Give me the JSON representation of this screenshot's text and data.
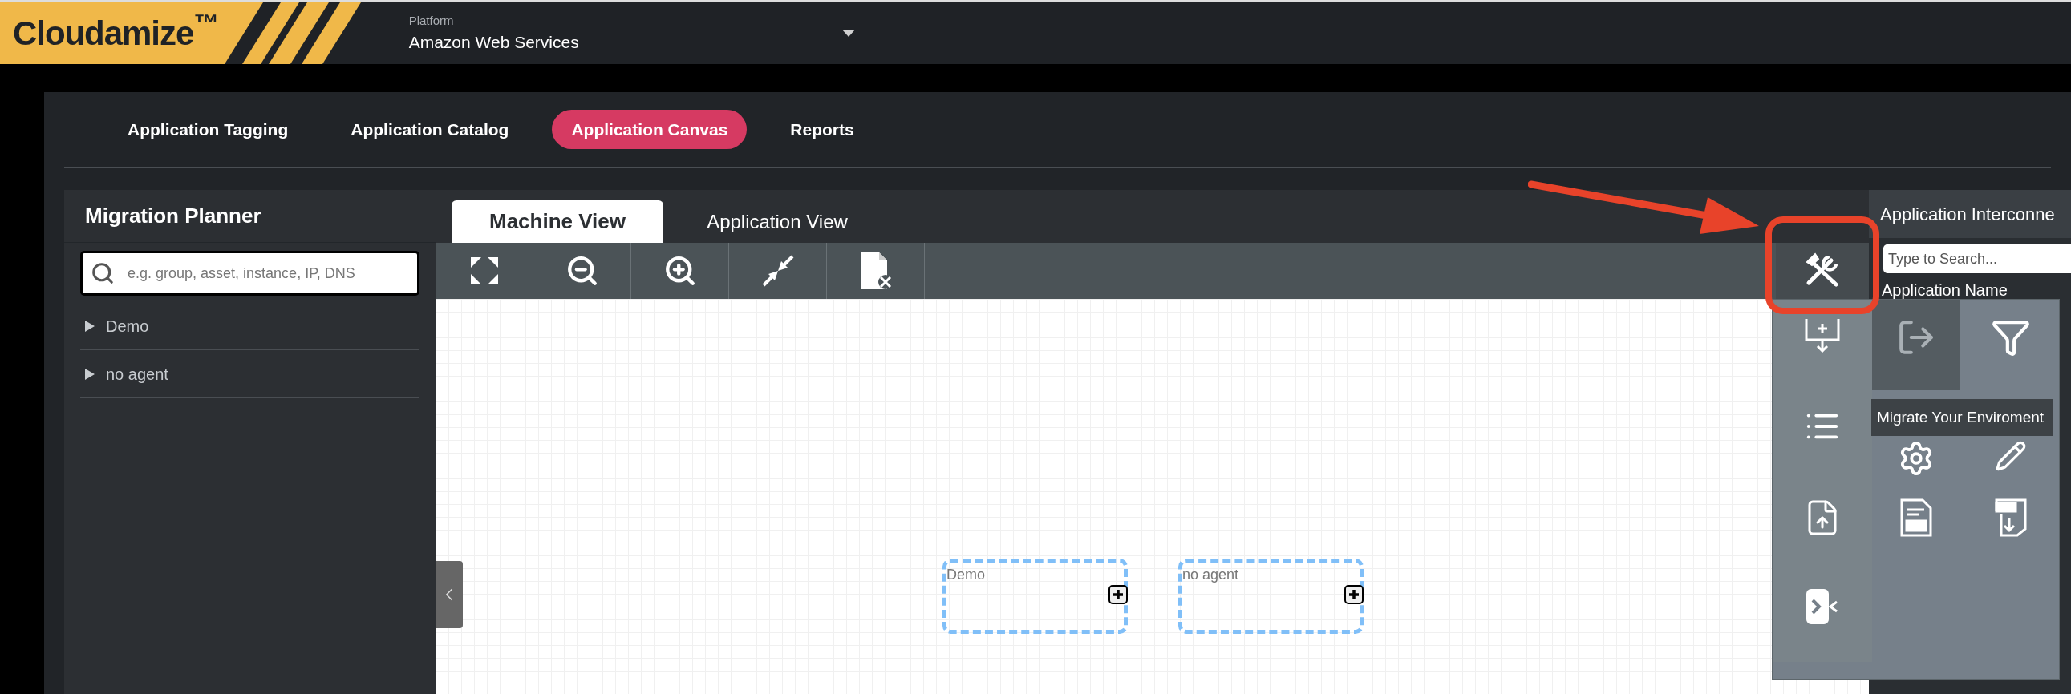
{
  "header": {
    "logo": "Cloudamize$^{™}$",
    "platform_label": "Platform",
    "platform_value": "Amazon Web Services"
  },
  "nav_tabs": [
    {
      "label": "Application Tagging",
      "selected": false
    },
    {
      "label": "Application Catalog",
      "selected": false
    },
    {
      "label": "Application Canvas",
      "selected": true
    },
    {
      "label": "Reports",
      "selected": false
    }
  ],
  "migration_planner": {
    "title": "Migration Planner",
    "search": {
      "placeholder": "e.g. group, asset, instance, IP, DNS"
    },
    "tree": [
      {
        "label": "Demo",
        "expanded": false
      },
      {
        "label": "no agent",
        "expanded": false
      }
    ]
  },
  "view_tabs": [
    {
      "label": "Machine View",
      "selected": true
    },
    {
      "label": "Application View",
      "selected": false
    }
  ],
  "canvas": {
    "nodes": [
      {
        "label": "Demo"
      },
      {
        "label": "no agent"
      }
    ]
  },
  "tools_menu": {
    "items": [
      {
        "highlighted": false
      },
      {
        "highlighted": true
      },
      {
        "highlighted": false
      },
      {
        "highlighted": false
      },
      {
        "highlighted": false
      },
      {
        "highlighted": false
      },
      {
        "highlighted": false
      },
      {
        "highlighted": false
      },
      {
        "highlighted": false
      },
      {
        "highlighted": false
      }
    ],
    "tooltip": "Migrate Your Enviroment"
  },
  "interconnections": {
    "title": "Application Interconne",
    "search": {
      "placeholder": "Type to Search..."
    },
    "column": "Application Name"
  }
}
